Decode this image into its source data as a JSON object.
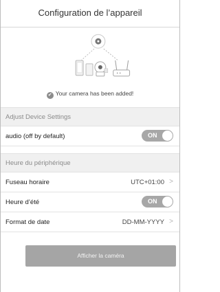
{
  "header": {
    "title": "Configuration de l’appareil"
  },
  "hero": {
    "message": "Your camera has been added!",
    "check_glyph": "✔"
  },
  "sections": {
    "adjust": "Adjust Device Settings",
    "time": "Heure du périphérique"
  },
  "rows": {
    "audio": {
      "label": "audio (off by default)",
      "toggle": "ON"
    },
    "timezone": {
      "label": "Fuseau horaire",
      "value": "UTC+01:00"
    },
    "dst": {
      "label": "Heure d’été",
      "toggle": "ON"
    },
    "date_format": {
      "label": "Format de date",
      "value": "DD-MM-YYYY"
    }
  },
  "chevron": ">",
  "actions": {
    "show_camera": "Afficher la caméra"
  },
  "icons": [
    "cloud-icon",
    "phone-icon",
    "tablet-icon",
    "camera-icon",
    "router-icon",
    "check-icon",
    "chevron-right-icon"
  ],
  "colors": {
    "toggle_on": "#a7a7a7",
    "button_bg": "#a5a5a5",
    "section_bg": "#f0f0f0"
  }
}
